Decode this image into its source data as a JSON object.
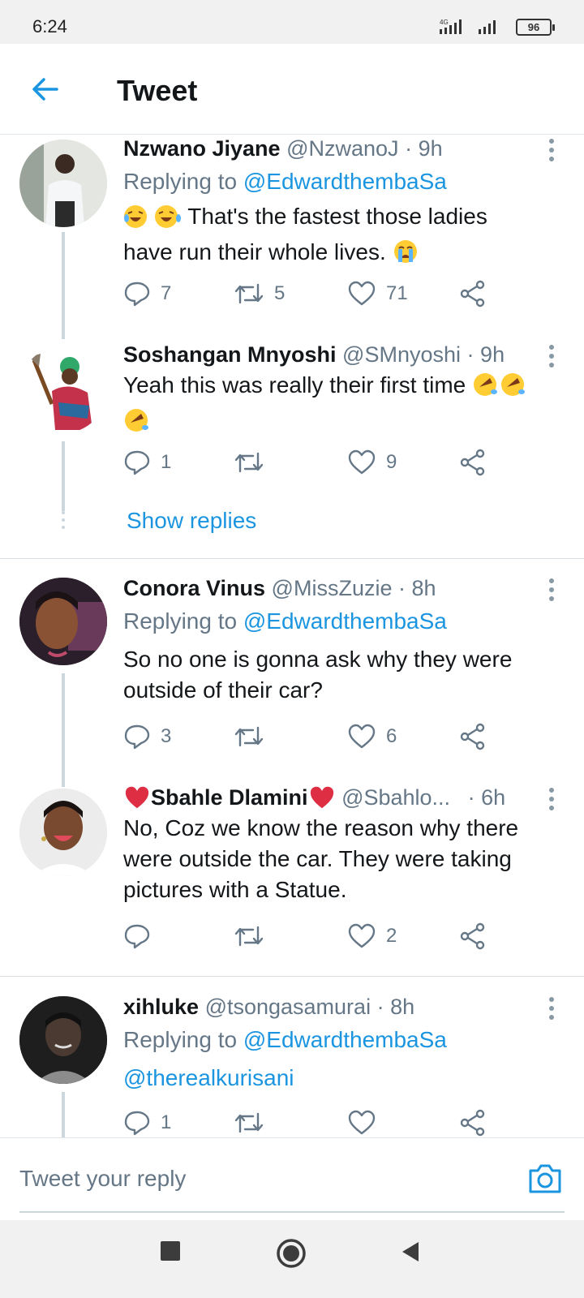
{
  "status_bar": {
    "time": "6:24",
    "network": "4G",
    "battery": "96"
  },
  "header": {
    "title": "Tweet"
  },
  "tweets": [
    {
      "name": "Nzwano Jiyane",
      "handle": "@NzwanoJ",
      "age": "9h",
      "replying_prefix": "Replying to ",
      "replying_to": "@EdwardthembaSa",
      "text_line1": "That's the fastest those ladies",
      "text_line2": "have run their whole lives.",
      "replies": "7",
      "retweets": "5",
      "likes": "71"
    },
    {
      "name": "Soshangan Mnyoshi",
      "handle": "@SMnyoshi",
      "age": "9h",
      "text_line1": "Yeah this was really their first time",
      "replies": "1",
      "retweets": "",
      "likes": "9"
    },
    {
      "name": "Conora Vinus",
      "handle": "@MissZuzie",
      "age": "8h",
      "replying_prefix": "Replying to ",
      "replying_to": "@EdwardthembaSa",
      "text_line1": "So no one is gonna ask why they were",
      "text_line2": "outside of their car?",
      "replies": "3",
      "retweets": "",
      "likes": "6"
    },
    {
      "name": "Sbahle Dlamini",
      "handle": "@Sbahlo...",
      "age": "6h",
      "text_line1": "No, Coz we know the reason why there",
      "text_line2": "were outside the car. They were taking",
      "text_line3": "pictures with a Statue.",
      "replies": "",
      "retweets": "",
      "likes": "2"
    },
    {
      "name": "xihluke",
      "handle": "@tsongasamurai",
      "age": "8h",
      "replying_prefix": "Replying to ",
      "replying_to": "@EdwardthembaSa",
      "text_line1": "@therealkurisani",
      "replies": "1",
      "retweets": "",
      "likes": ""
    }
  ],
  "show_replies": "Show replies",
  "reply_box": {
    "placeholder": "Tweet your reply"
  },
  "colors": {
    "accent": "#1b95e0",
    "muted": "#657786",
    "text": "#14171a"
  }
}
